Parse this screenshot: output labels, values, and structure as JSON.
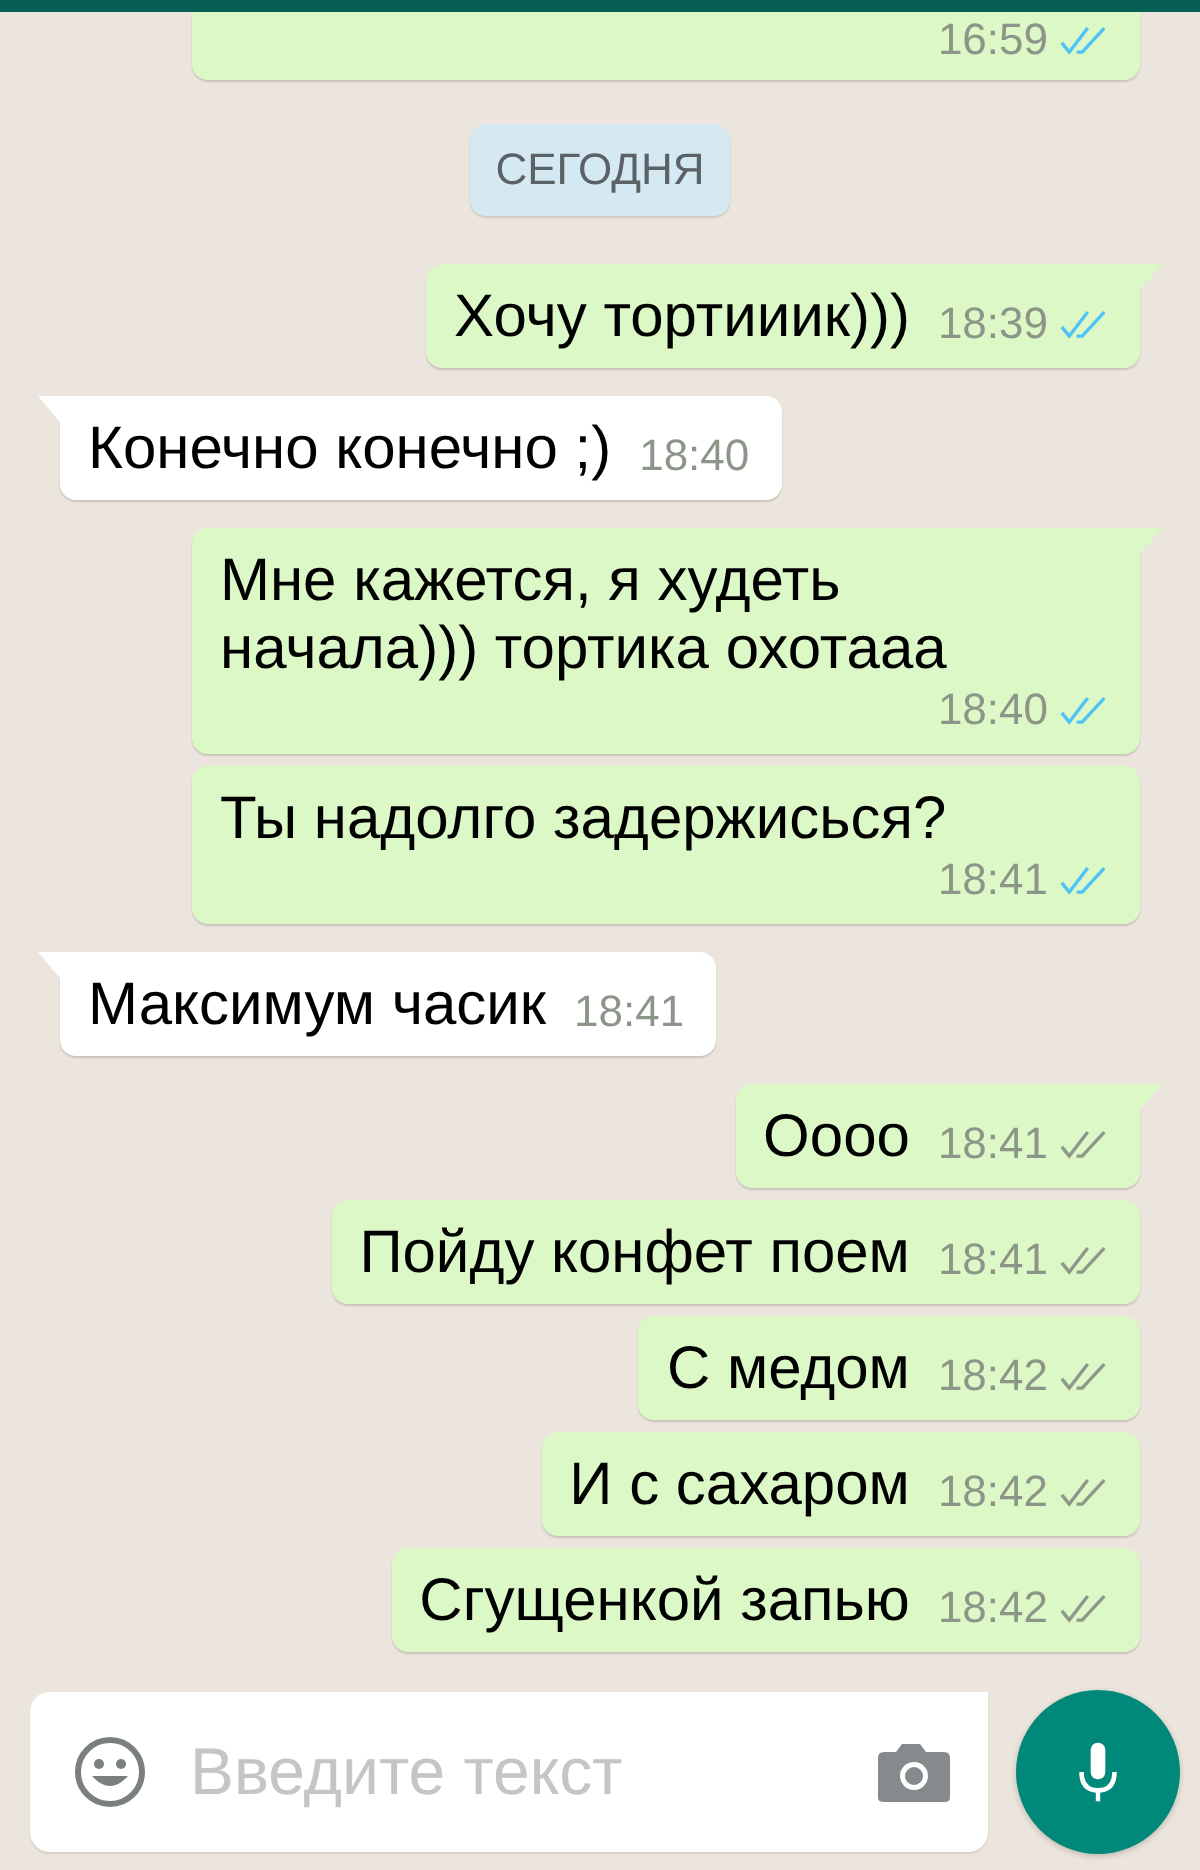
{
  "messages": [
    {
      "kind": "outgoing",
      "time": "16:59",
      "read": true
    },
    {
      "kind": "date",
      "text": "СЕГОДНЯ"
    },
    {
      "kind": "outgoing",
      "text": "Хочу тортииик)))",
      "time": "18:39",
      "read": true
    },
    {
      "kind": "incoming",
      "text": "Конечно конечно ;)",
      "time": "18:40"
    },
    {
      "kind": "outgoing",
      "text": "Мне кажется, я худеть начала))) тортика охотааа",
      "time": "18:40",
      "read": true
    },
    {
      "kind": "outgoing",
      "text": "Ты надолго задержисься?",
      "time": "18:41",
      "read": true
    },
    {
      "kind": "incoming",
      "text": "Максимум часик",
      "time": "18:41"
    },
    {
      "kind": "outgoing",
      "text": "Оооо",
      "time": "18:41",
      "read": false
    },
    {
      "kind": "outgoing",
      "text": "Пойду конфет поем",
      "time": "18:41",
      "read": false
    },
    {
      "kind": "outgoing",
      "text": "С медом",
      "time": "18:42",
      "read": false
    },
    {
      "kind": "outgoing",
      "text": "И с сахаром",
      "time": "18:42",
      "read": false
    },
    {
      "kind": "outgoing",
      "text": "Сгущенкой запью",
      "time": "18:42",
      "read": false
    }
  ],
  "composer": {
    "placeholder": "Введите текст"
  }
}
